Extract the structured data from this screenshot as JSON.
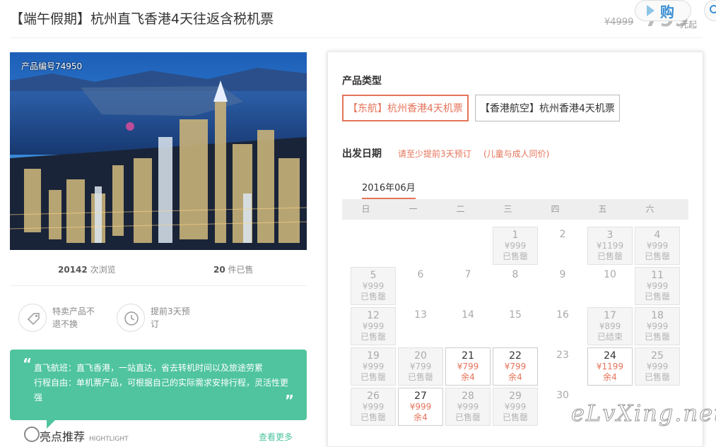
{
  "header": {
    "title": "【端午假期】杭州直飞香港4天往返含税机票",
    "old_price": "¥4999",
    "price": "799",
    "price_unit": "元起",
    "buy_label": "购"
  },
  "product": {
    "id_label": "产品编号74950",
    "views_count": "20142",
    "views_label": "次浏览",
    "sold_count": "20",
    "sold_label": "件已售",
    "features": [
      {
        "icon": "tag-icon",
        "text": "特卖产品不退不换"
      },
      {
        "icon": "clock-icon",
        "text": "提前3天预订"
      }
    ],
    "intro_lines": [
      "直飞航班：直飞香港，一站直达，省去转机时间以及旅途劳累",
      "行程自由：单机票产品，可根据自己的实际需求安排行程，灵活性更强"
    ],
    "highlight_title": "亮点推荐",
    "highlight_sub": "HIGHTLIGHT",
    "more_label": "查看更多"
  },
  "booking": {
    "type_title": "产品类型",
    "types": [
      {
        "label": "【东航】杭州香港4天机票",
        "selected": true
      },
      {
        "label": "【香港航空】杭州香港4天机票",
        "selected": false
      }
    ],
    "date_title": "出发日期",
    "hint1": "请至少提前3天预订",
    "hint2": "(儿童与成人同价)",
    "month": "2016年06月",
    "weekdays": [
      "日",
      "一",
      "二",
      "三",
      "四",
      "五",
      "六"
    ],
    "days": [
      {
        "d": "1",
        "price": "¥999",
        "status": "已售罄",
        "state": "soldout"
      },
      {
        "d": "2",
        "price": "",
        "status": "",
        "state": "empty"
      },
      {
        "d": "3",
        "price": "¥1199",
        "status": "已售罄",
        "state": "soldout"
      },
      {
        "d": "4",
        "price": "¥999",
        "status": "已售罄",
        "state": "soldout"
      },
      {
        "d": "5",
        "price": "¥999",
        "status": "已售罄",
        "state": "soldout"
      },
      {
        "d": "6",
        "price": "",
        "status": "",
        "state": "empty"
      },
      {
        "d": "7",
        "price": "",
        "status": "",
        "state": "empty"
      },
      {
        "d": "8",
        "price": "",
        "status": "",
        "state": "empty"
      },
      {
        "d": "9",
        "price": "",
        "status": "",
        "state": "empty"
      },
      {
        "d": "10",
        "price": "",
        "status": "",
        "state": "empty"
      },
      {
        "d": "11",
        "price": "¥999",
        "status": "已售罄",
        "state": "soldout"
      },
      {
        "d": "12",
        "price": "¥999",
        "status": "已售罄",
        "state": "soldout"
      },
      {
        "d": "13",
        "price": "",
        "status": "",
        "state": "empty"
      },
      {
        "d": "14",
        "price": "",
        "status": "",
        "state": "empty"
      },
      {
        "d": "15",
        "price": "",
        "status": "",
        "state": "empty"
      },
      {
        "d": "16",
        "price": "",
        "status": "",
        "state": "empty"
      },
      {
        "d": "17",
        "price": "¥899",
        "status": "已结束",
        "state": "soldout"
      },
      {
        "d": "18",
        "price": "¥999",
        "status": "已售罄",
        "state": "soldout"
      },
      {
        "d": "19",
        "price": "¥999",
        "status": "已售罄",
        "state": "soldout"
      },
      {
        "d": "20",
        "price": "¥799",
        "status": "已售罄",
        "state": "soldout"
      },
      {
        "d": "21",
        "price": "¥799",
        "status": "余4",
        "state": "avail"
      },
      {
        "d": "22",
        "price": "¥799",
        "status": "余4",
        "state": "avail"
      },
      {
        "d": "23",
        "price": "",
        "status": "",
        "state": "empty"
      },
      {
        "d": "24",
        "price": "¥1199",
        "status": "余4",
        "state": "avail"
      },
      {
        "d": "25",
        "price": "¥999",
        "status": "已售罄",
        "state": "soldout"
      },
      {
        "d": "26",
        "price": "¥999",
        "status": "已售罄",
        "state": "soldout"
      },
      {
        "d": "27",
        "price": "¥999",
        "status": "余4",
        "state": "avail"
      },
      {
        "d": "28",
        "price": "¥999",
        "status": "已售罄",
        "state": "soldout"
      },
      {
        "d": "29",
        "price": "¥999",
        "status": "已售罄",
        "state": "soldout"
      },
      {
        "d": "30",
        "price": "",
        "status": "",
        "state": "empty"
      }
    ]
  },
  "watermark": "eLvXing.net",
  "colors": {
    "accent": "#e5735a",
    "green": "#4fc49f",
    "link_blue": "#3b8fd4"
  }
}
